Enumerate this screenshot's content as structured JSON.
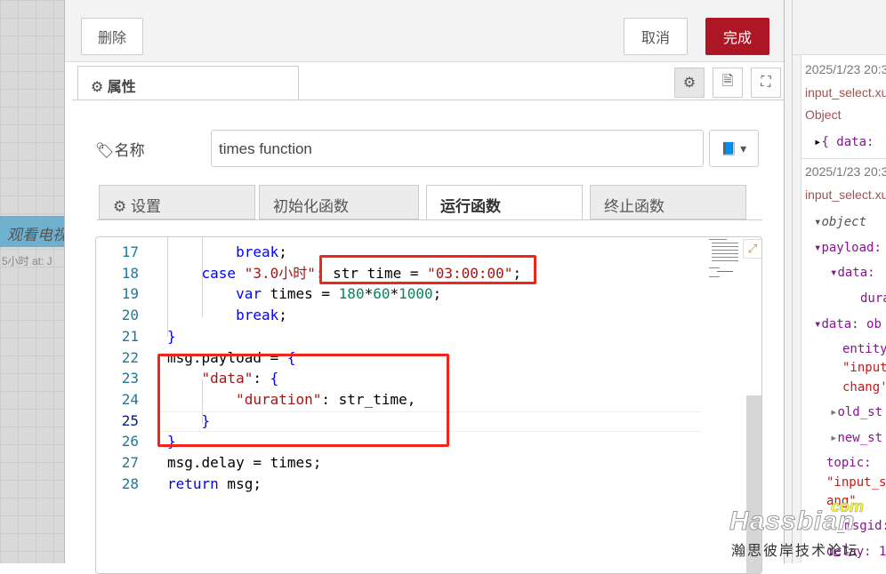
{
  "canvas": {
    "node_label": "观看电视",
    "node_status": "5小时 at: J"
  },
  "dialog": {
    "delete_label": "删除",
    "cancel_label": "取消",
    "done_label": "完成",
    "properties_tab": "属性",
    "name_label": "名称",
    "name_value": "times function",
    "func_tabs": [
      "设置",
      "初始化函数",
      "运行函数",
      "终止函数"
    ],
    "active_tab": "运行函数",
    "colors": {
      "done": "#ad1625",
      "highlight": "#f0261c"
    }
  },
  "editor": {
    "lines": [
      {
        "n": "17",
        "code": [
          [
            "        ",
            ""
          ],
          [
            "break",
            "kw"
          ],
          [
            ";",
            ""
          ]
        ]
      },
      {
        "n": "18",
        "code": [
          [
            "    ",
            ""
          ],
          [
            "case",
            "kw"
          ],
          [
            " ",
            ""
          ],
          [
            "\"3.0小时\"",
            "str"
          ],
          [
            ": str time = ",
            ""
          ],
          [
            "\"03:00:00\"",
            "str"
          ],
          [
            ";",
            ""
          ]
        ]
      },
      {
        "n": "19",
        "code": [
          [
            "        ",
            ""
          ],
          [
            "var",
            "kw"
          ],
          [
            " times = ",
            ""
          ],
          [
            "180",
            "num"
          ],
          [
            "*",
            ""
          ],
          [
            "60",
            "num"
          ],
          [
            "*",
            ""
          ],
          [
            "1000",
            "num"
          ],
          [
            ";",
            ""
          ]
        ]
      },
      {
        "n": "20",
        "code": [
          [
            "        ",
            ""
          ],
          [
            "break",
            "kw"
          ],
          [
            ";",
            ""
          ]
        ]
      },
      {
        "n": "21",
        "code": [
          [
            "}",
            "kw"
          ]
        ]
      },
      {
        "n": "22",
        "code": [
          [
            "msg.payload = ",
            ""
          ],
          [
            "{",
            "kw"
          ]
        ]
      },
      {
        "n": "23",
        "code": [
          [
            "    ",
            ""
          ],
          [
            "\"data\"",
            "str"
          ],
          [
            ": ",
            ""
          ],
          [
            "{",
            "kw"
          ]
        ]
      },
      {
        "n": "24",
        "code": [
          [
            "        ",
            ""
          ],
          [
            "\"duration\"",
            "str"
          ],
          [
            ": str_time,",
            ""
          ]
        ]
      },
      {
        "n": "25",
        "code": [
          [
            "    ",
            ""
          ],
          [
            "}",
            "kw"
          ]
        ]
      },
      {
        "n": "26",
        "code": [
          [
            "}",
            "kw"
          ]
        ]
      },
      {
        "n": "27",
        "code": [
          [
            "msg.delay = times;",
            ""
          ]
        ]
      },
      {
        "n": "28",
        "code": [
          [
            "return",
            "kw"
          ],
          [
            " msg;",
            ""
          ]
        ]
      }
    ]
  },
  "debug": {
    "msg1": {
      "timestamp": "2025/1/23 20:3",
      "topic": "input_select.xu",
      "type": "Object",
      "preview": "{ data:"
    },
    "msg2": {
      "timestamp": "2025/1/23 20:3",
      "topic": "input_select.xu",
      "root": "object",
      "payload": "payload:",
      "data": "data:",
      "duration": "dura",
      "data2": "data: ob",
      "entity": "entity",
      "input": "\"input",
      "chang": "chang'",
      "old_state": "old_st",
      "new_state": "new_st",
      "topic_key": "topic:",
      "topic_val": "\"input_s",
      "topic_end": "ang\"",
      "msgid": "_msgid:",
      "delay": "delay: 1"
    }
  },
  "watermark": {
    "brand": "Hassbian",
    "com": "com",
    "subtitle": "瀚思彼岸技术论坛"
  }
}
